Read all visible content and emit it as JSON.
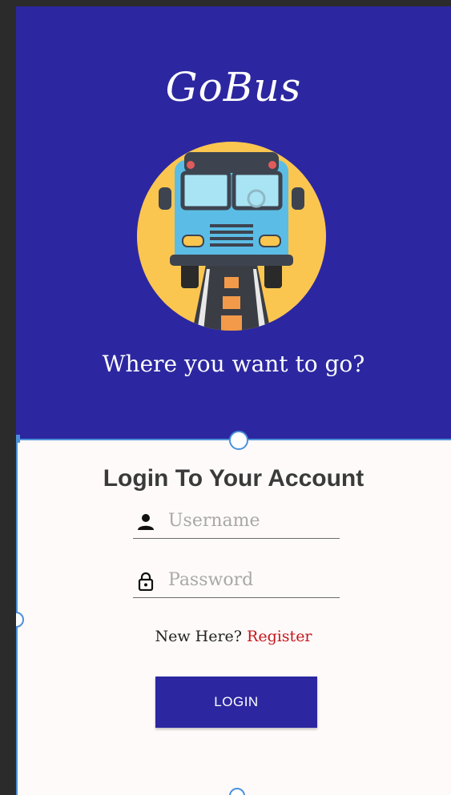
{
  "app": {
    "brand": "GoBus",
    "tagline": "Where you want to go?"
  },
  "login": {
    "title": "Login To Your Account",
    "username_placeholder": "Username",
    "password_placeholder": "Password",
    "register_prompt": "New Here?",
    "register_link": "Register",
    "login_button": "LOGIN"
  },
  "icons": {
    "user": "person-icon",
    "password": "lock-icon",
    "logo": "bus-logo-icon"
  },
  "colors": {
    "primary": "#2c27a0",
    "background": "#fffafa",
    "link": "#c4161c",
    "logo_circle": "#fbc650",
    "bus_body": "#5bbde6"
  }
}
